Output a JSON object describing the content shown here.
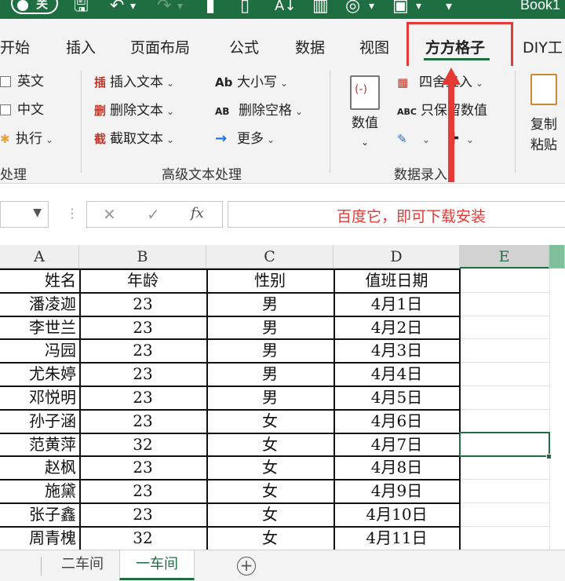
{
  "titlebar": {
    "autosave_label": "关",
    "book_name": "Book1"
  },
  "tabs": [
    "开始",
    "插入",
    "页面布局",
    "公式",
    "数据",
    "视图",
    "方方格子",
    "DIY工"
  ],
  "active_tab": "方方格子",
  "ribbon": {
    "left_items": {
      "english": "英文",
      "chinese": "中文",
      "execute": "执行"
    },
    "left_group_label": "处理",
    "advanced_text": {
      "insert_text": "插入文本",
      "delete_text": "删除文本",
      "extract_text": "截取文本",
      "case": "大小写",
      "delete_spaces": "删除空格",
      "more": "更多",
      "group_label": "高级文本处理"
    },
    "number_entry": {
      "values_big": "数值",
      "round": "四舍五入",
      "keep_values": "只保留数值",
      "group_label": "数据录入"
    },
    "paste": {
      "copy_paste": "复制粘贴"
    },
    "icons": {
      "insert": "插",
      "delete": "删",
      "extract": "截",
      "case": "Ab",
      "delete_space": "AB",
      "keep_values": "ABC"
    }
  },
  "formula_bar": {
    "fx": "fx",
    "cancel": "✕",
    "confirm": "✓",
    "value": "百度它，即可下载安装"
  },
  "columns": [
    "A",
    "B",
    "C",
    "D",
    "E"
  ],
  "selected_column": "E",
  "table": {
    "headers": [
      "姓名",
      "年龄",
      "性别",
      "值班日期"
    ],
    "rows": [
      {
        "name": "潘凌迦",
        "age": "23",
        "gender": "男",
        "date": "4月1日"
      },
      {
        "name": "李世兰",
        "age": "23",
        "gender": "男",
        "date": "4月2日"
      },
      {
        "name": "冯园",
        "age": "23",
        "gender": "男",
        "date": "4月3日"
      },
      {
        "name": "尤朱婷",
        "age": "23",
        "gender": "男",
        "date": "4月4日"
      },
      {
        "name": "邓悦明",
        "age": "23",
        "gender": "男",
        "date": "4月5日"
      },
      {
        "name": "孙子涵",
        "age": "23",
        "gender": "女",
        "date": "4月6日"
      },
      {
        "name": "范黄萍",
        "age": "32",
        "gender": "女",
        "date": "4月7日"
      },
      {
        "name": "赵枫",
        "age": "23",
        "gender": "女",
        "date": "4月8日"
      },
      {
        "name": "施黛",
        "age": "23",
        "gender": "女",
        "date": "4月9日"
      },
      {
        "name": "张子鑫",
        "age": "23",
        "gender": "女",
        "date": "4月10日"
      },
      {
        "name": "周青槐",
        "age": "32",
        "gender": "女",
        "date": "4月11日"
      }
    ]
  },
  "sheets": [
    "二车间",
    "一车间"
  ],
  "active_sheet": "一车间",
  "colors": {
    "excel_green": "#1e6e42",
    "highlight_red": "#e53935"
  }
}
